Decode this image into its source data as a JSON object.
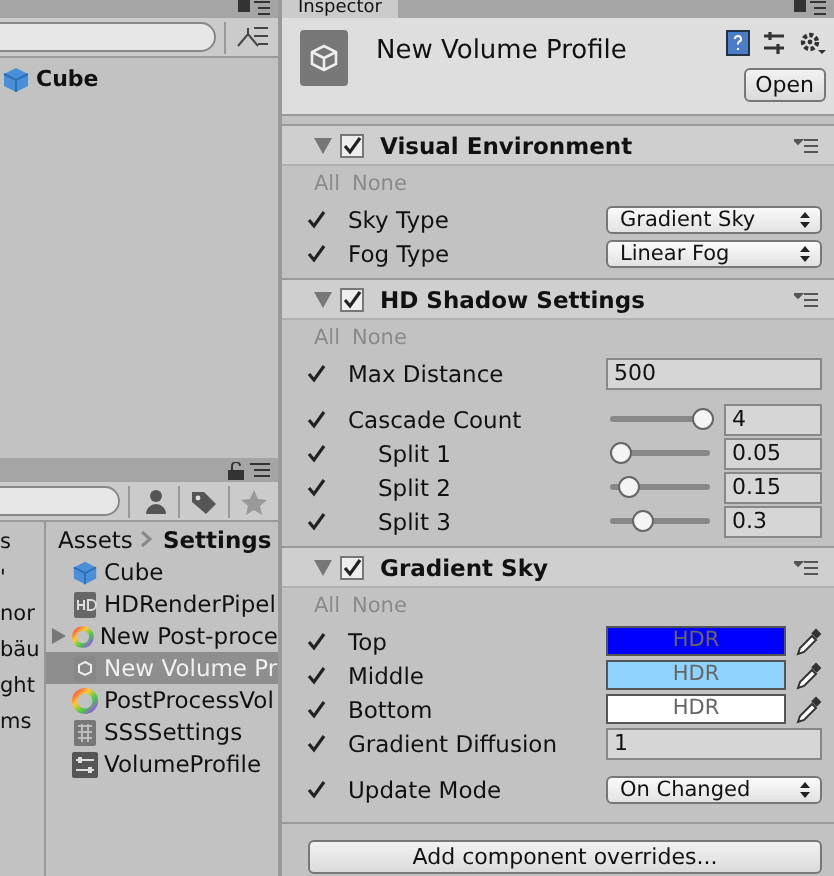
{
  "hierarchy": {
    "items": [
      {
        "label": "Cube"
      }
    ]
  },
  "project": {
    "breadcrumb": [
      "Assets",
      "Settings"
    ],
    "folder_column": [
      "s",
      "'",
      "nor",
      "bäu",
      "ght",
      "ms"
    ],
    "items": [
      {
        "label": "Cube",
        "kind": "mesh",
        "has_children": false,
        "selected": false
      },
      {
        "label": "HDRenderPipel",
        "kind": "pipeline",
        "has_children": false,
        "selected": false
      },
      {
        "label": "New Post-proce",
        "kind": "postprocess",
        "has_children": true,
        "selected": false
      },
      {
        "label": "New Volume Pr",
        "kind": "volume",
        "has_children": false,
        "selected": true
      },
      {
        "label": "PostProcessVol",
        "kind": "postprocess",
        "has_children": false,
        "selected": false
      },
      {
        "label": "SSSSettings",
        "kind": "settings",
        "has_children": false,
        "selected": false
      },
      {
        "label": "VolumeProfile",
        "kind": "profile",
        "has_children": false,
        "selected": false
      }
    ]
  },
  "inspector": {
    "tab": "Inspector",
    "title": "New Volume Profile",
    "open_button": "Open",
    "sections": [
      {
        "title": "Visual Environment",
        "expanded": true,
        "enabled": true,
        "all": "All",
        "none": "None",
        "rows": [
          {
            "kind": "dropdown",
            "label": "Sky Type",
            "checked": true,
            "indented": false,
            "value": "Gradient Sky"
          },
          {
            "kind": "dropdown",
            "label": "Fog Type",
            "checked": true,
            "indented": false,
            "value": "Linear Fog"
          }
        ]
      },
      {
        "title": "HD Shadow Settings",
        "expanded": true,
        "enabled": true,
        "all": "All",
        "none": "None",
        "rows": [
          {
            "kind": "number",
            "label": "Max Distance",
            "checked": true,
            "indented": false,
            "value": "500"
          },
          {
            "kind": "slider",
            "label": "Cascade Count",
            "checked": true,
            "indented": false,
            "level": 1,
            "value": "4"
          },
          {
            "kind": "slider",
            "label": "Split 1",
            "checked": true,
            "indented": true,
            "level": 0.05,
            "value": "0.05"
          },
          {
            "kind": "slider",
            "label": "Split 2",
            "checked": true,
            "indented": true,
            "level": 0.15,
            "value": "0.15"
          },
          {
            "kind": "slider",
            "label": "Split 3",
            "checked": true,
            "indented": true,
            "level": 0.3,
            "value": "0.3"
          }
        ]
      },
      {
        "title": "Gradient Sky",
        "expanded": true,
        "enabled": true,
        "all": "All",
        "none": "None",
        "rows": [
          {
            "kind": "color",
            "label": "Top",
            "checked": true,
            "indented": false,
            "color": "#0000ff",
            "value": "HDR"
          },
          {
            "kind": "color",
            "label": "Middle",
            "checked": true,
            "indented": false,
            "color": "#8fd3ff",
            "value": "HDR"
          },
          {
            "kind": "color",
            "label": "Bottom",
            "checked": true,
            "indented": false,
            "color": "#ffffff",
            "value": "HDR"
          },
          {
            "kind": "number",
            "label": "Gradient Diffusion",
            "checked": true,
            "indented": false,
            "value": "1"
          },
          {
            "kind": "dropdown",
            "label": "Update Mode",
            "checked": true,
            "indented": false,
            "value": "On Changed"
          }
        ]
      }
    ],
    "add_button": "Add component overrides..."
  }
}
